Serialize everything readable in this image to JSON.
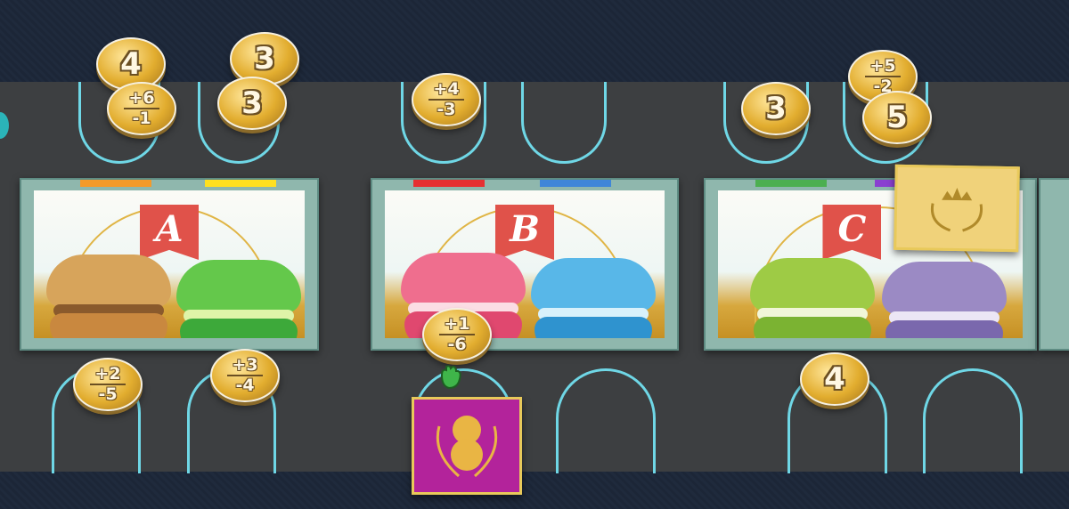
{
  "colors": {
    "board": "#3d3f41",
    "lane": "#6fd7e6",
    "coin": "#e2ad2f",
    "tile_purple": "#b3239b",
    "tile_gold": "#f0d27a"
  },
  "cards": [
    {
      "letter": "A",
      "stripes": [
        "#f39a2a",
        "#ffe020"
      ],
      "macarons": [
        {
          "top": "#d7a45b",
          "fill": "#8a5a2c",
          "bot": "#c9883f"
        },
        {
          "top": "#64c84b",
          "fill": "#dff4a8",
          "bot": "#3da93a"
        }
      ]
    },
    {
      "letter": "B",
      "stripes": [
        "#e63032",
        "#3f86d8"
      ],
      "macarons": [
        {
          "top": "#ef6e8e",
          "fill": "#fbdde4",
          "bot": "#e0486f"
        },
        {
          "top": "#58b7e8",
          "fill": "#d8f1fb",
          "bot": "#2f93cf"
        }
      ]
    },
    {
      "letter": "C",
      "stripes": [
        "#4caf50",
        "#8a3fd0"
      ],
      "macarons": [
        {
          "top": "#9ecb45",
          "fill": "#f1f6d8",
          "bot": "#7bb332"
        },
        {
          "top": "#9b8ac4",
          "fill": "#ece6f5",
          "bot": "#7a68ad"
        }
      ]
    }
  ],
  "coins": [
    {
      "id": "coin-4-top-a",
      "kind": "single",
      "value": "4"
    },
    {
      "id": "coin-plus6-minus1",
      "kind": "double",
      "plus": "+6",
      "minus": "-1"
    },
    {
      "id": "coin-3-top-a",
      "kind": "single",
      "value": "3"
    },
    {
      "id": "coin-3-top-b",
      "kind": "single",
      "value": "3"
    },
    {
      "id": "coin-plus4-minus3",
      "kind": "double",
      "plus": "+4",
      "minus": "-3"
    },
    {
      "id": "coin-3-top-c",
      "kind": "single",
      "value": "3"
    },
    {
      "id": "coin-plus5-minus2",
      "kind": "double",
      "plus": "+5",
      "minus": "-2"
    },
    {
      "id": "coin-5-top",
      "kind": "single",
      "value": "5"
    },
    {
      "id": "coin-plus2-minus5",
      "kind": "double",
      "plus": "+2",
      "minus": "-5"
    },
    {
      "id": "coin-plus3-minus4",
      "kind": "double",
      "plus": "+3",
      "minus": "-4"
    },
    {
      "id": "coin-plus1-minus6",
      "kind": "double",
      "plus": "+1",
      "minus": "-6"
    },
    {
      "id": "coin-4-bottom",
      "kind": "single",
      "value": "4"
    }
  ],
  "tiles": [
    {
      "id": "crown-tile",
      "icon": "crown-wreath-icon"
    },
    {
      "id": "peanut-tile",
      "icon": "peanut-wreath-icon"
    }
  ]
}
